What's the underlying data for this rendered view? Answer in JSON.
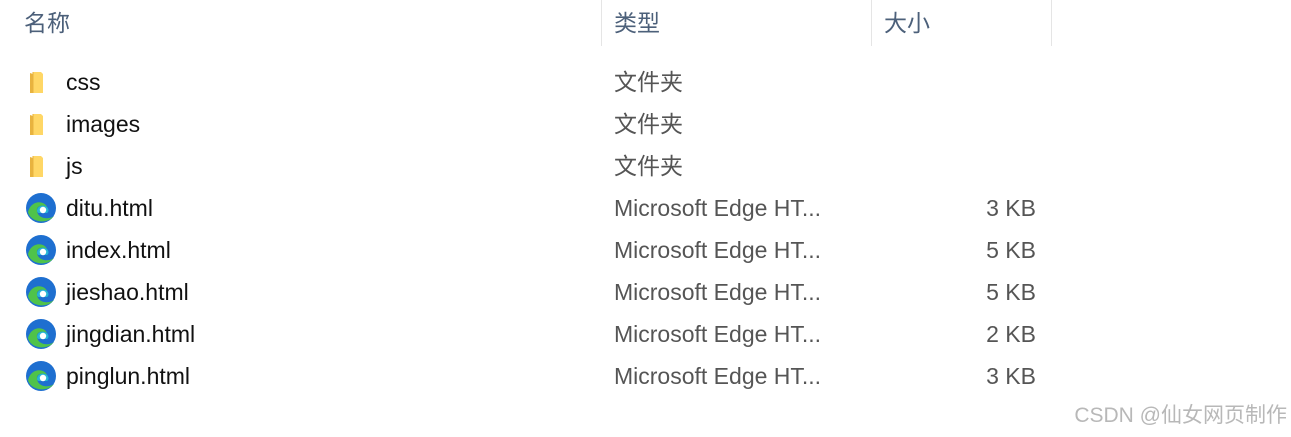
{
  "columns": {
    "name": "名称",
    "type": "类型",
    "size": "大小"
  },
  "files": [
    {
      "name": "css",
      "type": "文件夹",
      "size": "",
      "icon": "folder-icon"
    },
    {
      "name": "images",
      "type": "文件夹",
      "size": "",
      "icon": "folder-icon"
    },
    {
      "name": "js",
      "type": "文件夹",
      "size": "",
      "icon": "folder-icon"
    },
    {
      "name": "ditu.html",
      "type": "Microsoft Edge HT...",
      "size": "3 KB",
      "icon": "edge-html-icon"
    },
    {
      "name": "index.html",
      "type": "Microsoft Edge HT...",
      "size": "5 KB",
      "icon": "edge-html-icon"
    },
    {
      "name": "jieshao.html",
      "type": "Microsoft Edge HT...",
      "size": "5 KB",
      "icon": "edge-html-icon"
    },
    {
      "name": "jingdian.html",
      "type": "Microsoft Edge HT...",
      "size": "2 KB",
      "icon": "edge-html-icon"
    },
    {
      "name": "pinglun.html",
      "type": "Microsoft Edge HT...",
      "size": "3 KB",
      "icon": "edge-html-icon"
    }
  ],
  "watermark": "CSDN @仙女网页制作",
  "colors": {
    "header_text": "#4c607a",
    "folder_light": "#ffd766",
    "folder_dark": "#e8b33f",
    "edge_blue": "#1e6fd0",
    "edge_green": "#4fc34a",
    "edge_teal": "#27b5d6"
  }
}
